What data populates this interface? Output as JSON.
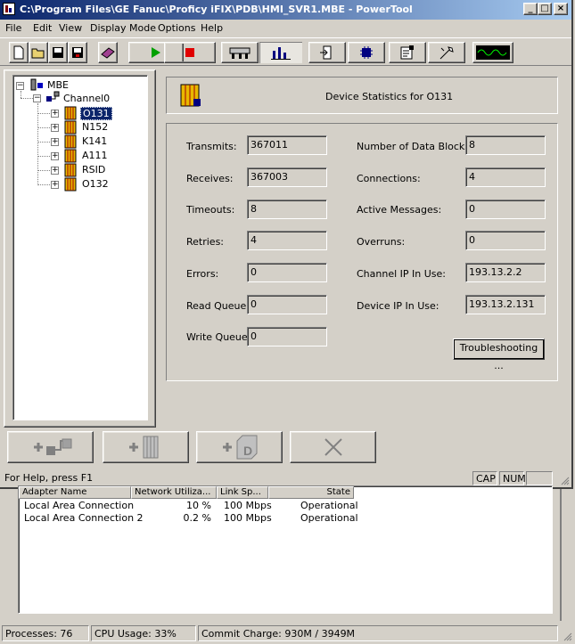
{
  "window": {
    "title": "C:\\Program Files\\GE Fanuc\\Proficy iFIX\\PDB\\HMI_SVR1.MBE - PowerTool",
    "controls": [
      "_",
      "□",
      "×"
    ]
  },
  "menu": [
    "File",
    "Edit",
    "View",
    "Display Mode",
    "Options",
    "Help"
  ],
  "toolbar": {
    "buttons": [
      "new-icon",
      "open-icon",
      "save-icon",
      "save-all-icon",
      "book-icon",
      "start-icon",
      "stop-icon",
      "config-icon",
      "statistics-icon",
      "import-icon",
      "network-icon",
      "properties-icon",
      "tools-icon",
      "signal-icon"
    ]
  },
  "tree": {
    "root": "MBE",
    "channel": "Channel0",
    "devices": [
      "O131",
      "N152",
      "K141",
      "A111",
      "RSID",
      "O132"
    ],
    "selected": "O131"
  },
  "header": {
    "title": "Device Statistics for O131"
  },
  "stats": {
    "left": [
      {
        "label": "Transmits:",
        "value": "367011"
      },
      {
        "label": "Receives:",
        "value": "367003"
      },
      {
        "label": "Timeouts:",
        "value": "8"
      },
      {
        "label": "Retries:",
        "value": "4"
      },
      {
        "label": "Errors:",
        "value": "0"
      },
      {
        "label": "Read Queue:",
        "value": "0"
      },
      {
        "label": "Write Queue:",
        "value": "0"
      }
    ],
    "right": [
      {
        "label": "Number of Data Blocks:",
        "value": "8"
      },
      {
        "label": "Connections:",
        "value": "4"
      },
      {
        "label": "Active Messages:",
        "value": "0"
      },
      {
        "label": "Overruns:",
        "value": "0"
      },
      {
        "label": "Channel IP In Use:",
        "value": "193.13.2.2"
      },
      {
        "label": "Device IP In Use:",
        "value": "193.13.2.131"
      }
    ],
    "troubleshooting_label": "Troubleshooting ..."
  },
  "bottom_buttons": [
    "add-channel-icon",
    "add-device-icon",
    "add-datablock-icon",
    "delete-icon"
  ],
  "status": {
    "help": "For Help, press F1",
    "cap": "CAP",
    "num": "NUM"
  },
  "network": {
    "columns": [
      "Adapter Name",
      "Network Utiliza...",
      "Link Sp...",
      "State"
    ],
    "rows": [
      {
        "name": "Local Area Connection",
        "util": "10 %",
        "speed": "100 Mbps",
        "state": "Operational"
      },
      {
        "name": "Local Area Connection 2",
        "util": "0.2 %",
        "speed": "100 Mbps",
        "state": "Operational"
      }
    ]
  },
  "taskmgr_status": {
    "processes": "Processes: 76",
    "cpu": "CPU Usage: 33%",
    "commit": "Commit Charge: 930M / 3949M"
  }
}
